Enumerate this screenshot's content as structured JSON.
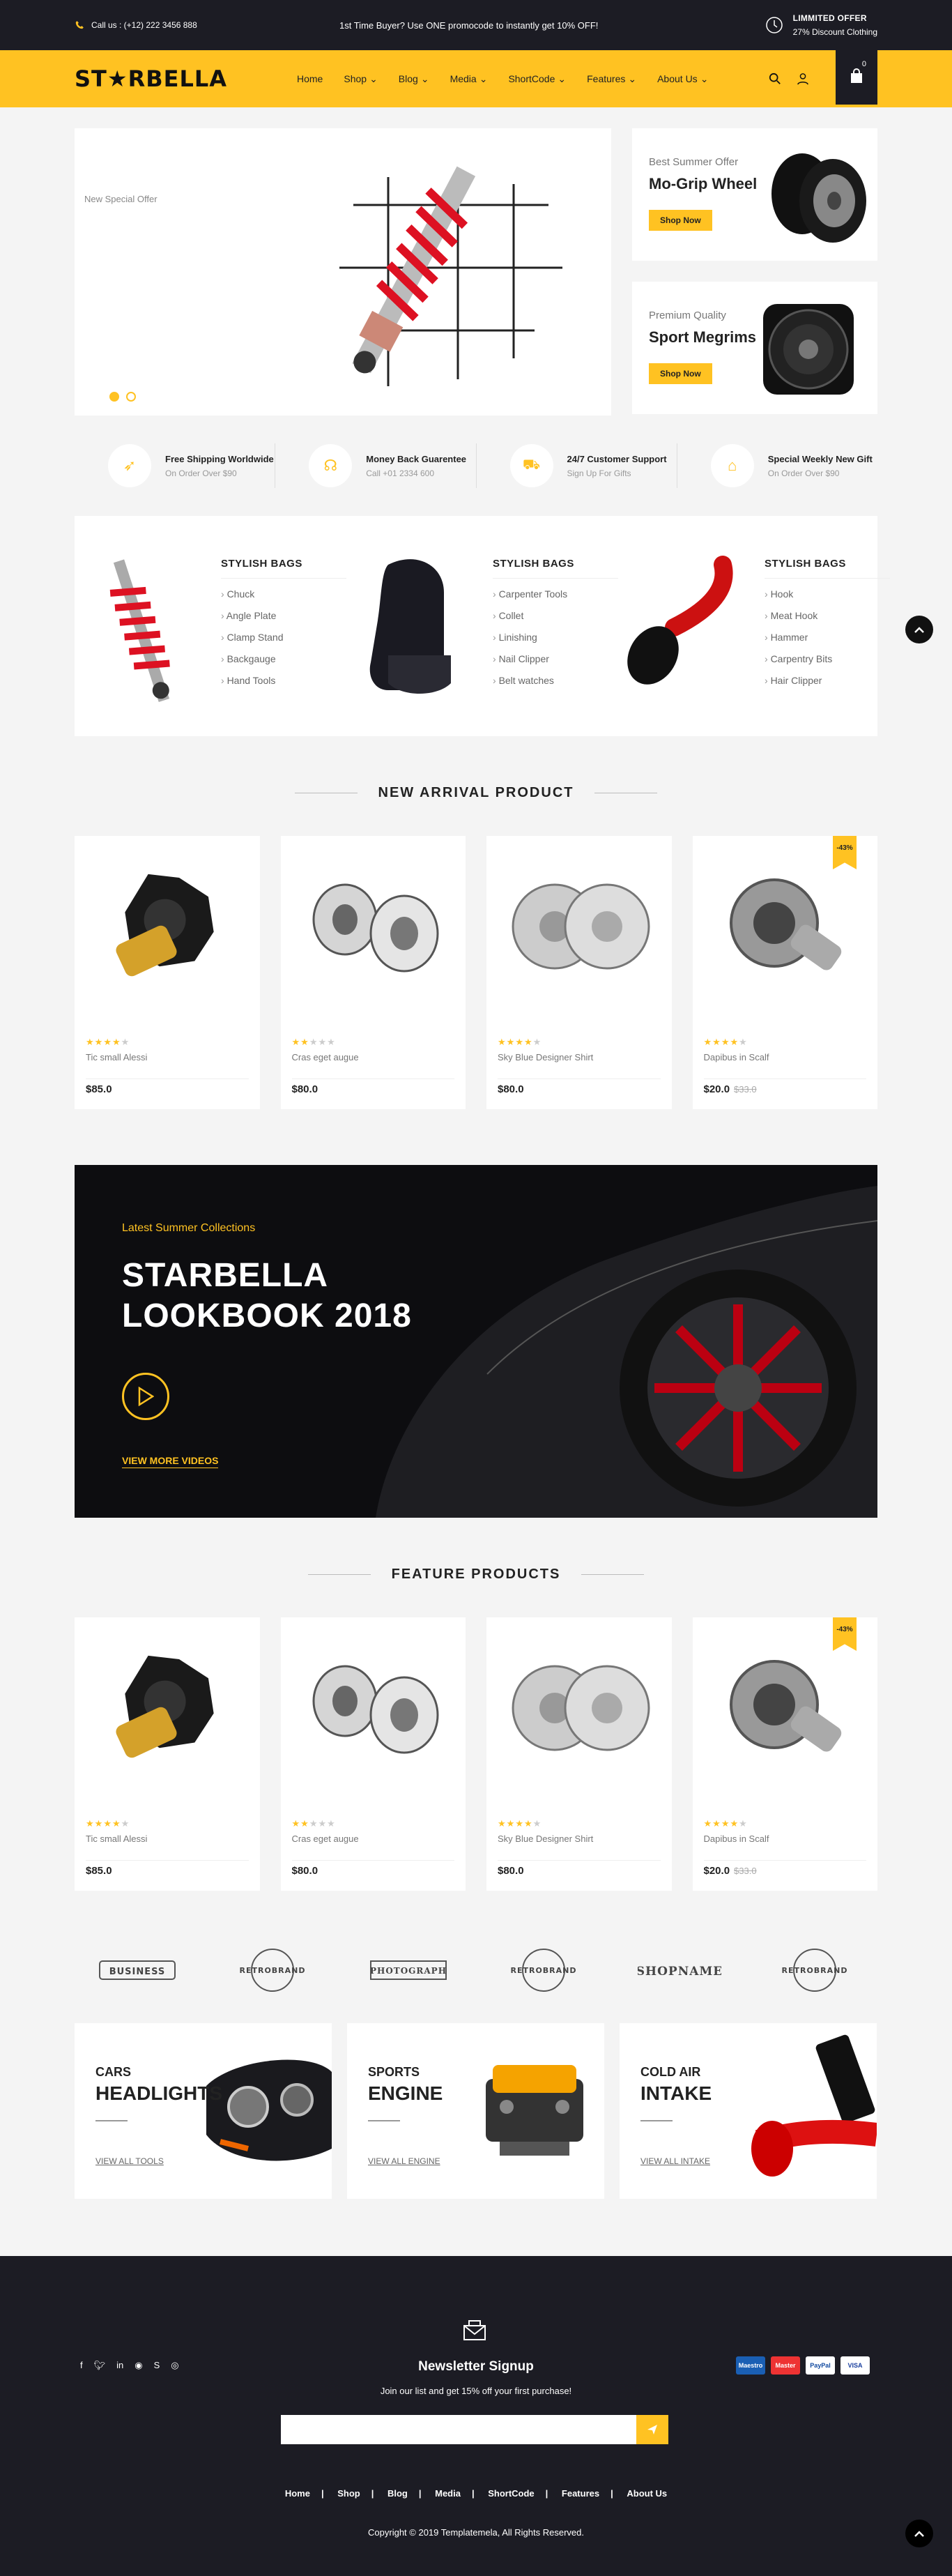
{
  "topbar": {
    "call": "Call us : (+12) 222 3456 888",
    "promo": "1st Time Buyer? Use ONE promocode to instantly get 10% OFF!",
    "offer_title": "LIMMITED OFFER",
    "offer_sub": "27% Discount Clothing"
  },
  "header": {
    "logo": "ST★RBELLA",
    "nav": [
      "Home",
      "Shop",
      "Blog",
      "Media",
      "ShortCode",
      "Features",
      "About Us"
    ],
    "cart_count": "0"
  },
  "slider": {
    "label": "New Special Offer"
  },
  "side_banners": [
    {
      "sub": "Best Summer Offer",
      "title": "Mo-Grip Wheel",
      "button": "Shop Now"
    },
    {
      "sub": "Premium Quality",
      "title": "Sport Megrims",
      "button": "Shop Now"
    }
  ],
  "services": [
    {
      "title": "Free Shipping Worldwide",
      "sub": "On Order Over $90"
    },
    {
      "title": "Money Back Guarentee",
      "sub": "Call +01 2334 600"
    },
    {
      "title": "24/7 Customer Support",
      "sub": "Sign Up For Gifts"
    },
    {
      "title": "Special Weekly New Gift",
      "sub": "On Order Over $90"
    }
  ],
  "categories": [
    {
      "title": "STYLISH BAGS",
      "items": [
        "Chuck",
        "Angle Plate",
        "Clamp Stand",
        "Backgauge",
        "Hand Tools"
      ]
    },
    {
      "title": "STYLISH BAGS",
      "items": [
        "Carpenter Tools",
        "Collet",
        "Linishing",
        "Nail Clipper",
        "Belt watches"
      ]
    },
    {
      "title": "STYLISH BAGS",
      "items": [
        "Hook",
        "Meat Hook",
        "Hammer",
        "Carpentry Bits",
        "Hair Clipper"
      ]
    }
  ],
  "new_arrival": {
    "title": "NEW ARRIVAL PRODUCT",
    "products": [
      {
        "name": "Tic small Alessi",
        "price": "$85.0",
        "old": "",
        "rating": 4,
        "badge": ""
      },
      {
        "name": "Cras eget augue",
        "price": "$80.0",
        "old": "",
        "rating": 2,
        "badge": ""
      },
      {
        "name": "Sky Blue Designer Shirt",
        "price": "$80.0",
        "old": "",
        "rating": 4,
        "badge": ""
      },
      {
        "name": "Dapibus in Scalf",
        "price": "$20.0",
        "old": "$33.0",
        "rating": 4,
        "badge": "-43%"
      }
    ]
  },
  "lookbook": {
    "sub": "Latest Summer Collections",
    "title1": "STARBELLA",
    "title2": "LOOKBOOK 2018",
    "link": "VIEW MORE VIDEOS"
  },
  "feature": {
    "title": "FEATURE PRODUCTS",
    "products": [
      {
        "name": "Tic small Alessi",
        "price": "$85.0",
        "old": "",
        "rating": 4,
        "badge": ""
      },
      {
        "name": "Cras eget augue",
        "price": "$80.0",
        "old": "",
        "rating": 2,
        "badge": ""
      },
      {
        "name": "Sky Blue Designer Shirt",
        "price": "$80.0",
        "old": "",
        "rating": 4,
        "badge": ""
      },
      {
        "name": "Dapibus in Scalf",
        "price": "$20.0",
        "old": "$33.0",
        "rating": 4,
        "badge": "-43%"
      }
    ]
  },
  "brands": [
    "BUSINESS",
    "RETROBRAND",
    "PHOTOGRAPH",
    "RETROBRAND",
    "SHOPNAME",
    "RETROBRAND"
  ],
  "promos": [
    {
      "t1": "CARS",
      "t2": "HEADLIGHTS",
      "link": "VIEW ALL TOOLS"
    },
    {
      "t1": "SPORTS",
      "t2": "ENGINE",
      "link": "VIEW ALL ENGINE"
    },
    {
      "t1": "COLD AIR",
      "t2": "INTAKE",
      "link": "VIEW ALL INTAKE"
    }
  ],
  "footer": {
    "newsletter_title": "Newsletter Signup",
    "newsletter_sub": "Join our list and get 15% off your first purchase!",
    "nav": [
      "Home",
      "Shop",
      "Blog",
      "Media",
      "ShortCode",
      "Features",
      "About Us"
    ],
    "copyright": "Copyright © 2019 Templatemela, All Rights Reserved.",
    "payments": [
      "Maestro",
      "Master",
      "PayPal",
      "VISA"
    ]
  },
  "colors": {
    "accent": "#ffc222",
    "dark": "#1c1c24"
  }
}
